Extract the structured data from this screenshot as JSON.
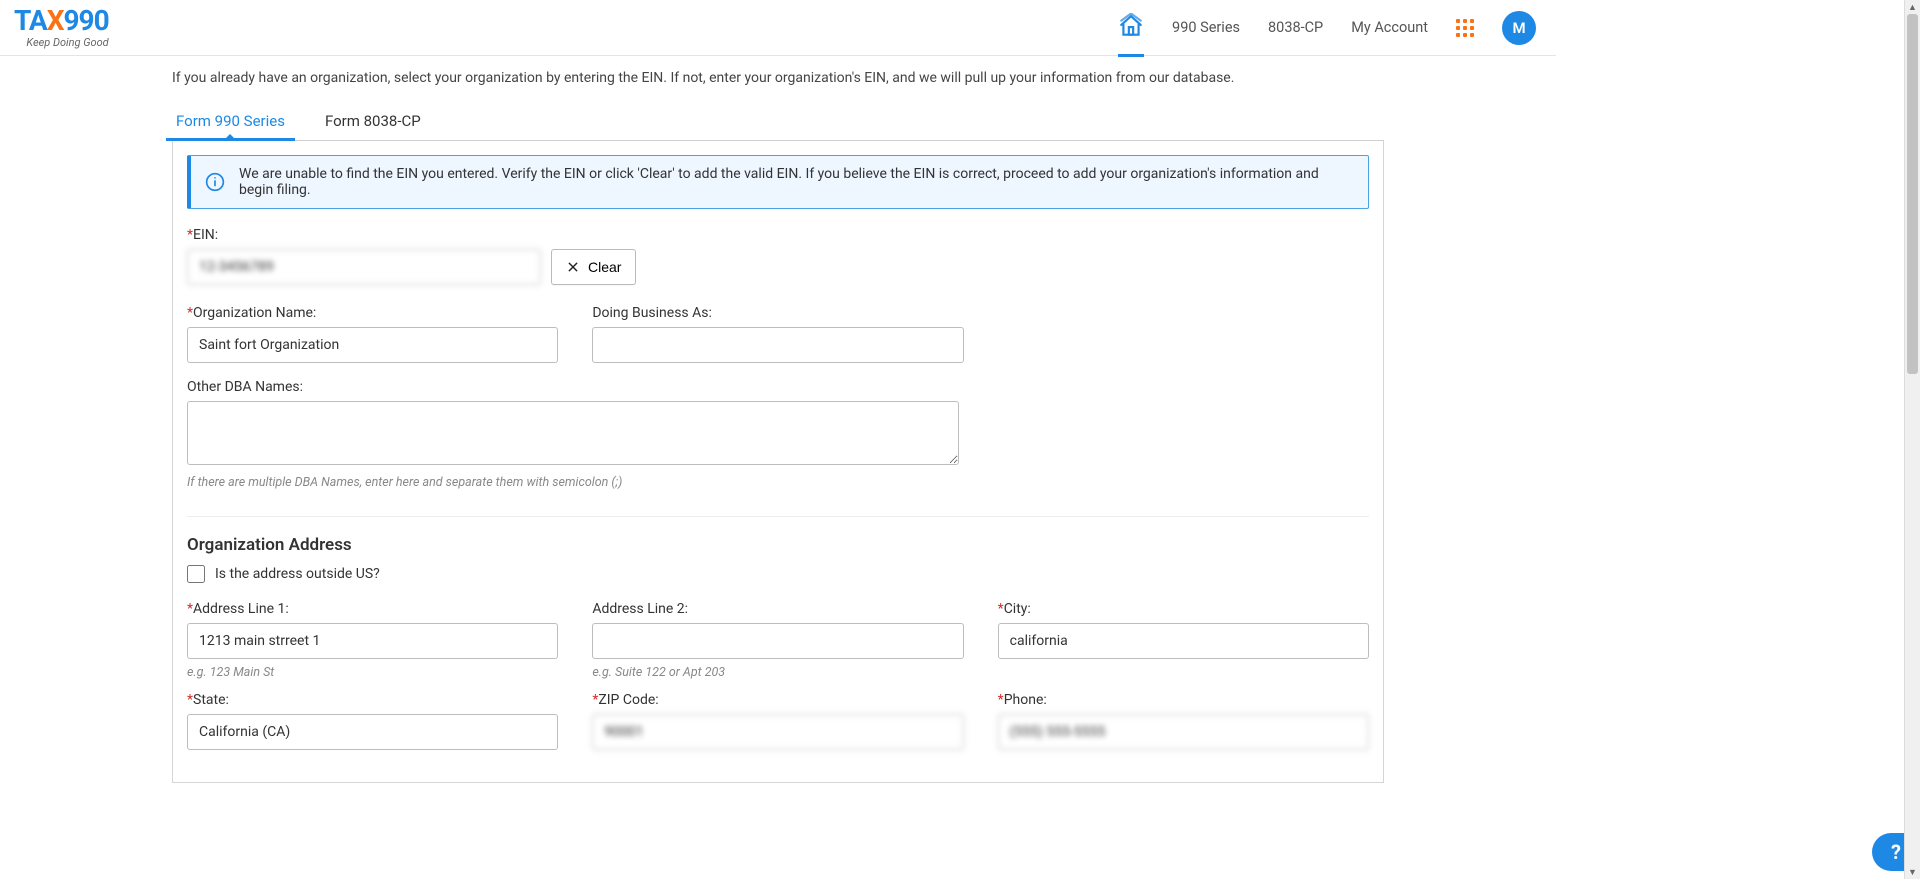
{
  "brand": {
    "name_pre": "TA",
    "name_x": "X",
    "name_post": "990",
    "tagline": "Keep Doing Good"
  },
  "nav": {
    "series": "990 Series",
    "cp": "8038-CP",
    "account": "My Account",
    "avatar_letter": "M"
  },
  "intro": "If you already have an organization, select your organization by entering the EIN. If not, enter your organization's EIN, and we will pull up your information from our database.",
  "tabs": {
    "t990": "Form 990 Series",
    "t8038": "Form 8038-CP"
  },
  "alert": {
    "text": "We are unable to find the EIN you entered. Verify the EIN or click 'Clear' to add the valid EIN. If you believe the EIN is correct, proceed to add your organization's information and begin filing."
  },
  "fields": {
    "ein_label": "EIN:",
    "ein_value": "12-3456789",
    "clear": "Clear",
    "org_name_label": "Organization Name:",
    "org_name_value": "Saint fort Organization",
    "dba_label": "Doing Business As:",
    "dba_value": "",
    "other_dba_label": "Other DBA Names:",
    "other_dba_value": "",
    "other_dba_hint": "If there are multiple DBA Names, enter here and separate them with semicolon (;)",
    "section_address": "Organization Address",
    "outside_us_label": "Is the address outside US?",
    "addr1_label": "Address Line 1:",
    "addr1_value": "1213 main strreet 1",
    "addr1_hint": "e.g. 123 Main St",
    "addr2_label": "Address Line 2:",
    "addr2_value": "",
    "addr2_hint": "e.g. Suite 122 or Apt 203",
    "city_label": "City:",
    "city_value": "california",
    "state_label": "State:",
    "state_value": "California (CA)",
    "zip_label": "ZIP Code:",
    "zip_value": "90001",
    "phone_label": "Phone:",
    "phone_value": "(555) 555-5555"
  },
  "help": "?"
}
